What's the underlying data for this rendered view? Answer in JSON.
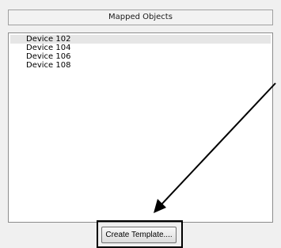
{
  "header": {
    "title": "Mapped Objects"
  },
  "list": {
    "items": [
      {
        "label": "Device 102"
      },
      {
        "label": "Device 104"
      },
      {
        "label": "Device 106"
      },
      {
        "label": "Device 108"
      }
    ]
  },
  "actions": {
    "create_template_label": "Create Template...."
  }
}
